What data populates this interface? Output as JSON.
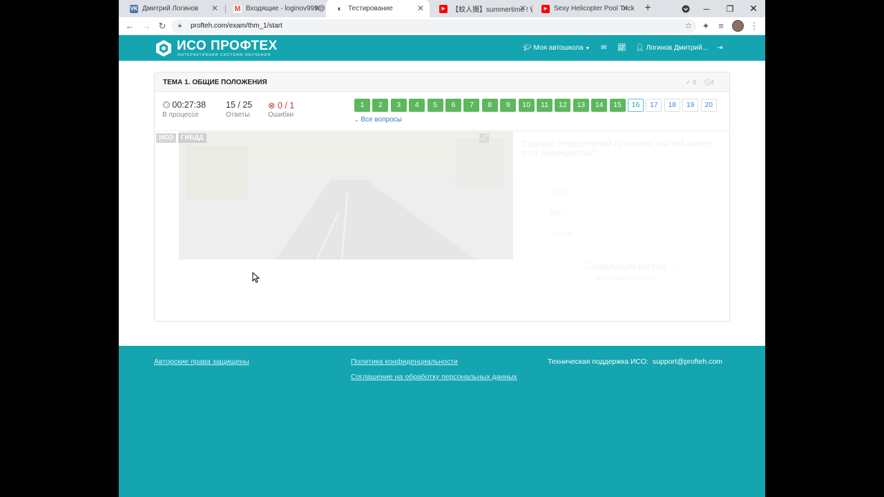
{
  "browser": {
    "tabs": [
      {
        "title": "Дмитрий Логинов",
        "icon": "vk-icon",
        "color": "#4a76a8",
        "glyph": "VK"
      },
      {
        "title": "Входящие - loginov999@",
        "icon": "gmail-icon",
        "color": "#ea4335",
        "glyph": "M"
      },
      {
        "title": "Тестирование",
        "icon": "site-icon",
        "color": "#14a5b0",
        "glyph": "◐"
      },
      {
        "title": "【蚊人摄】summertime ! W",
        "icon": "youtube-icon",
        "color": "#ff0000",
        "glyph": "▶"
      },
      {
        "title": "Sexy Helicopter Pool Trick",
        "icon": "youtube-icon",
        "color": "#ff0000",
        "glyph": "▶"
      }
    ],
    "active_tab": 2,
    "url": "profteh.com/exam/thm_1/start"
  },
  "header": {
    "logo_title": "ИСО ПРОФТЕХ",
    "logo_subtitle": "ИНТЕРАКТИВНАЯ СИСТЕМА ОБУЧЕНИЯ",
    "school_menu": "Моя автошкола",
    "user_name": "Логинов Дмитрий..."
  },
  "exam": {
    "topic_title": "ТЕМА 1. ОБЩИЕ ПОЛОЖЕНИЯ",
    "correct_count": "8",
    "skipped_count": "4",
    "timer": "00:27:38",
    "status": "В процессе",
    "answers_value": "15 / 25",
    "answers_label": "Ответы",
    "errors_value": "0 / 1",
    "errors_label": "Ошибки",
    "questions": [
      {
        "n": "1",
        "state": "done"
      },
      {
        "n": "2",
        "state": "done"
      },
      {
        "n": "3",
        "state": "done"
      },
      {
        "n": "4",
        "state": "done"
      },
      {
        "n": "5",
        "state": "done"
      },
      {
        "n": "6",
        "state": "done"
      },
      {
        "n": "7",
        "state": "done"
      },
      {
        "n": "8",
        "state": "done"
      },
      {
        "n": "9",
        "state": "done"
      },
      {
        "n": "10",
        "state": "done"
      },
      {
        "n": "11",
        "state": "done"
      },
      {
        "n": "12",
        "state": "done"
      },
      {
        "n": "13",
        "state": "done"
      },
      {
        "n": "14",
        "state": "done"
      },
      {
        "n": "15",
        "state": "done"
      },
      {
        "n": "16",
        "state": "current"
      },
      {
        "n": "17",
        "state": "todo"
      },
      {
        "n": "18",
        "state": "todo"
      },
      {
        "n": "19",
        "state": "todo"
      },
      {
        "n": "20",
        "state": "todo"
      }
    ],
    "all_questions_label": "Все вопросы",
    "badge_iso": "ИСО",
    "badge_gibdd": "ГИБДД",
    "question_text": "Сколько пересечений проезжих частей имеет этот перекресток?",
    "answers": [
      "Одно",
      "Два",
      "Четыре"
    ],
    "next_button": "Следующий вопрос →",
    "next_hint": "или нажмите пробел"
  },
  "footer": {
    "copyright": "Авторские права защищены",
    "privacy": "Политика конфиденциальности",
    "consent": "Соглашение на обработку персональных данных",
    "support_label": "Техническая поддержка ИСО:",
    "support_email": "support@profteh.com"
  },
  "colors": {
    "brand": "#14a5b0",
    "done": "#5cb85c",
    "current": "#5bc0de",
    "error": "#c0392b"
  }
}
